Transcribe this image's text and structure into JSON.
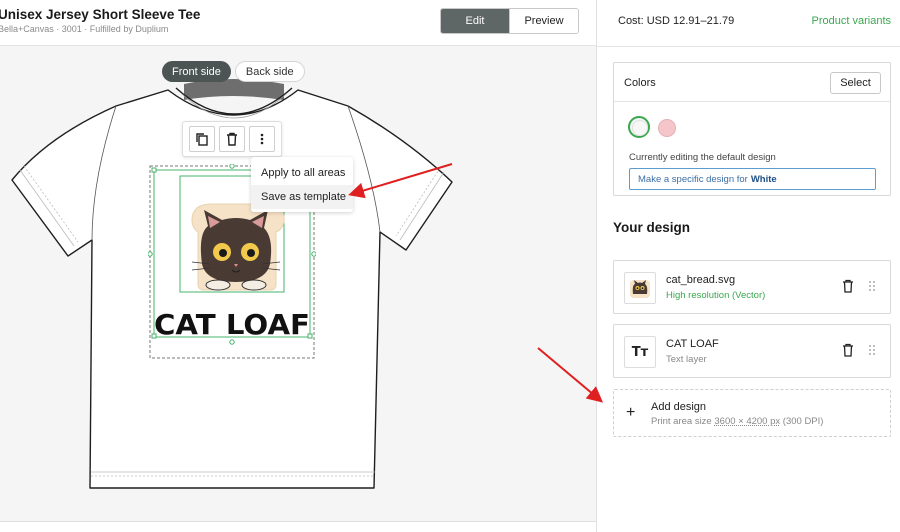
{
  "header": {
    "title": "Unisex Jersey Short Sleeve Tee",
    "subtitle": "Bella+Canvas · 3001 · Fulfilled by Duplium",
    "edit_label": "Edit",
    "preview_label": "Preview"
  },
  "canvas": {
    "front_tab": "Front side",
    "back_tab": "Back side",
    "context_menu": {
      "apply_all": "Apply to all areas",
      "save_template": "Save as template"
    },
    "artwork_text": "CAT LOAF"
  },
  "panel": {
    "cost": "Cost: USD 12.91–21.79",
    "variants_link": "Product variants",
    "colors": {
      "label": "Colors",
      "select_label": "Select",
      "swatches": [
        {
          "name": "White",
          "color": "#f4f4f4",
          "selected": true
        },
        {
          "name": "Pink",
          "color": "#f4c6c9",
          "selected": false
        }
      ],
      "editing_text": "Currently editing the default design",
      "specific_prefix": "Make a specific design for",
      "specific_color": "White"
    },
    "your_design": "Your design",
    "layers": [
      {
        "name": "cat_bread.svg",
        "sub": "High resolution (Vector)"
      },
      {
        "name": "CAT LOAF",
        "sub": "Text layer",
        "thumb_glyph": "Tт"
      }
    ],
    "add_design": {
      "label": "Add design",
      "sub_prefix": "Print area size",
      "dims": "3600 × 4200 px",
      "dpi": "(300 DPI)"
    }
  },
  "colors": {
    "accent_green": "#3aa84f",
    "edit_bg": "#5e6666",
    "arrow_red": "#e02020"
  }
}
